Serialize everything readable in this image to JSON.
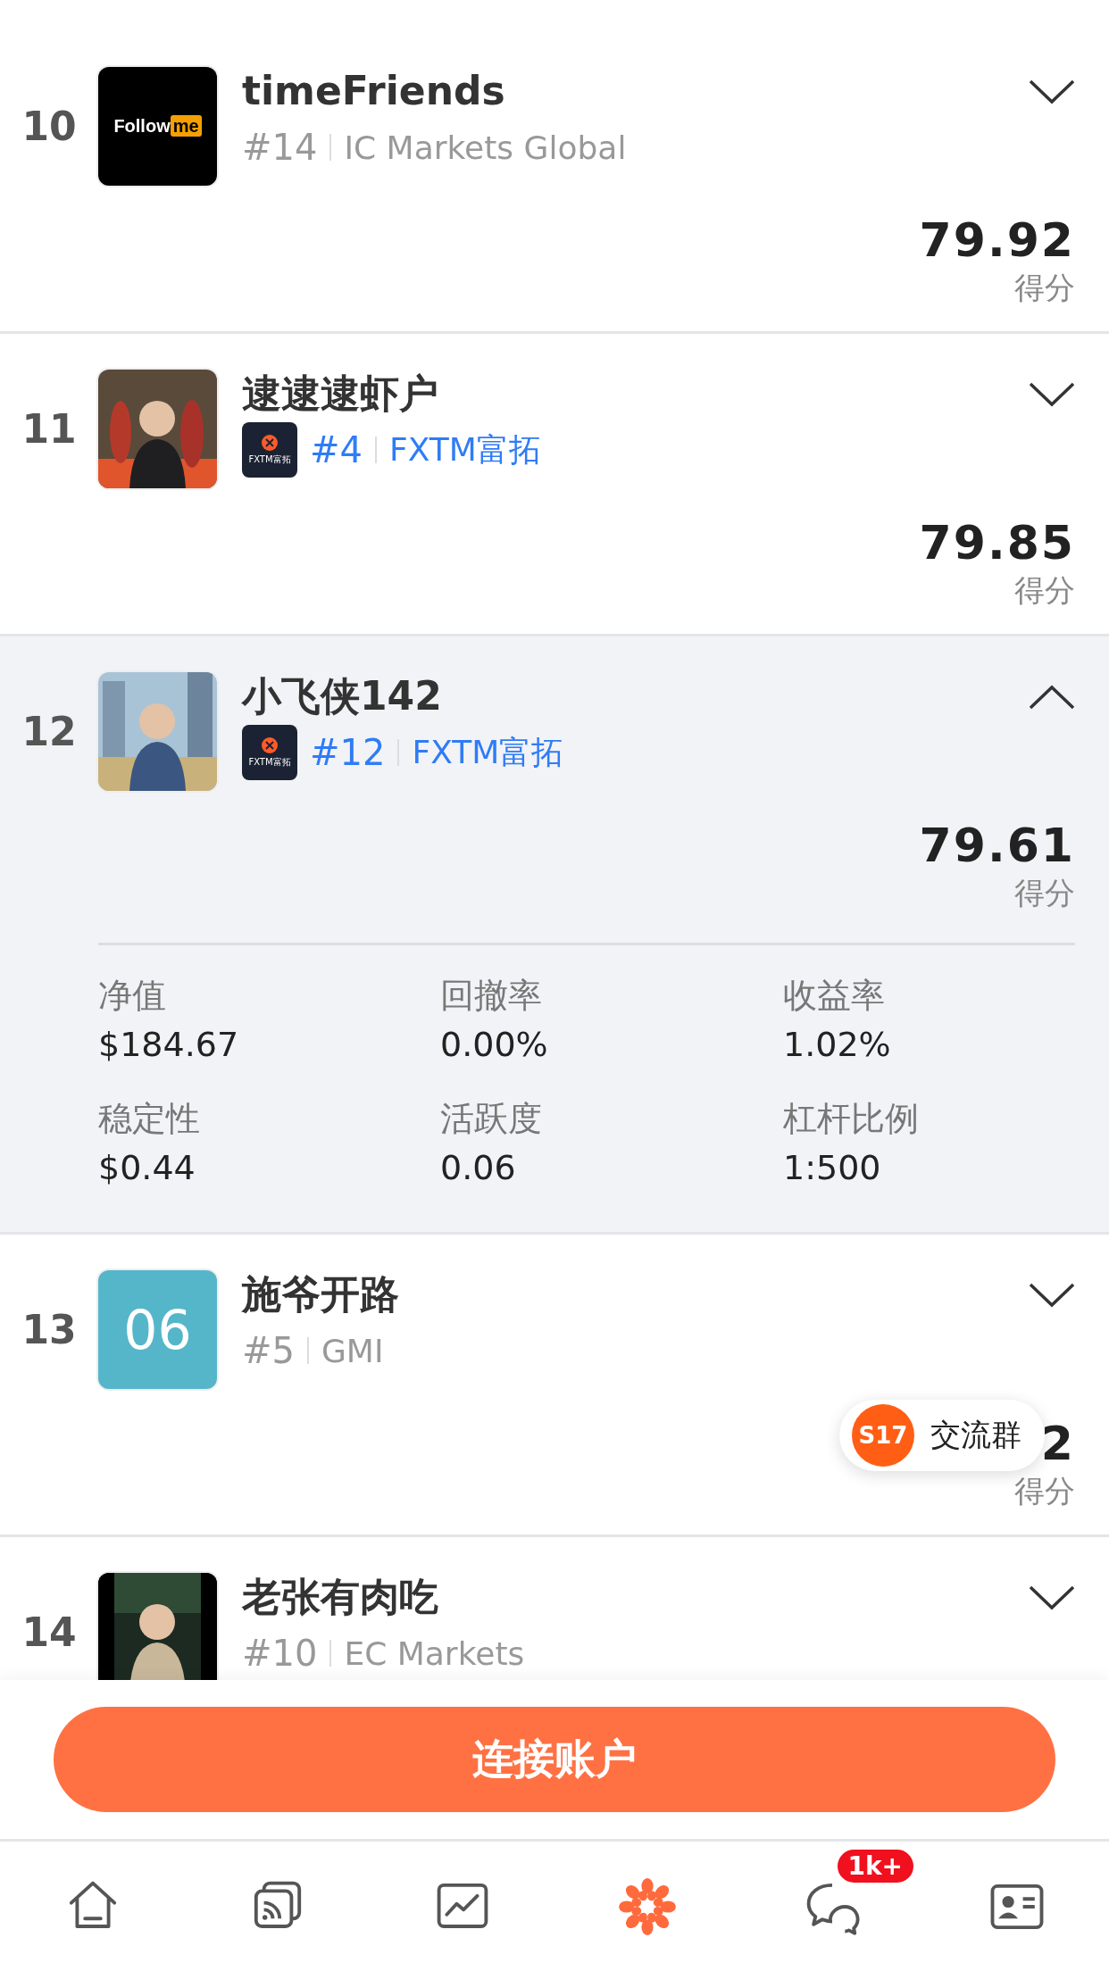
{
  "rows": [
    {
      "rank": "10",
      "avatar": {
        "kind": "logo",
        "text": "Follow",
        "highlight": "me"
      },
      "name": "timeFriends",
      "broker_rank": "#14",
      "broker": "IC Markets Global",
      "linked": false,
      "expanded": false,
      "score": "79.92",
      "score_label": "得分"
    },
    {
      "rank": "11",
      "name": "逮逮逮虾户",
      "broker_logo_text": "FXTM富拓",
      "broker_rank": "#4",
      "broker": "FXTM富拓",
      "linked": true,
      "expanded": false,
      "score": "79.85",
      "score_label": "得分"
    },
    {
      "rank": "12",
      "name": "小飞侠142",
      "broker_logo_text": "FXTM富拓",
      "broker_rank": "#12",
      "broker": "FXTM富拓",
      "linked": true,
      "expanded": true,
      "score": "79.61",
      "score_label": "得分",
      "stats": [
        {
          "label": "净值",
          "value": "$184.67"
        },
        {
          "label": "回撤率",
          "value": "0.00%"
        },
        {
          "label": "收益率",
          "value": "1.02%"
        },
        {
          "label": "稳定性",
          "value": "$0.44"
        },
        {
          "label": "活跃度",
          "value": "0.06"
        },
        {
          "label": "杠杆比例",
          "value": "1:500"
        }
      ]
    },
    {
      "rank": "13",
      "avatar": {
        "kind": "tile",
        "text": "06"
      },
      "name": "施爷开路",
      "broker_rank": "#5",
      "broker": "GMI",
      "linked": false,
      "expanded": false,
      "score": "2",
      "score_label": "得分"
    },
    {
      "rank": "14",
      "name": "老张有肉吃",
      "broker_rank": "#10",
      "broker": "EC Markets",
      "linked": false,
      "expanded": false
    }
  ],
  "float_button": {
    "badge": "S17",
    "label": "交流群"
  },
  "connect_button": "连接账户",
  "nav": [
    {
      "selected": false
    },
    {
      "selected": false
    },
    {
      "selected": false
    },
    {
      "selected": true
    },
    {
      "selected": false,
      "badge": "1k+"
    },
    {
      "selected": false
    }
  ]
}
